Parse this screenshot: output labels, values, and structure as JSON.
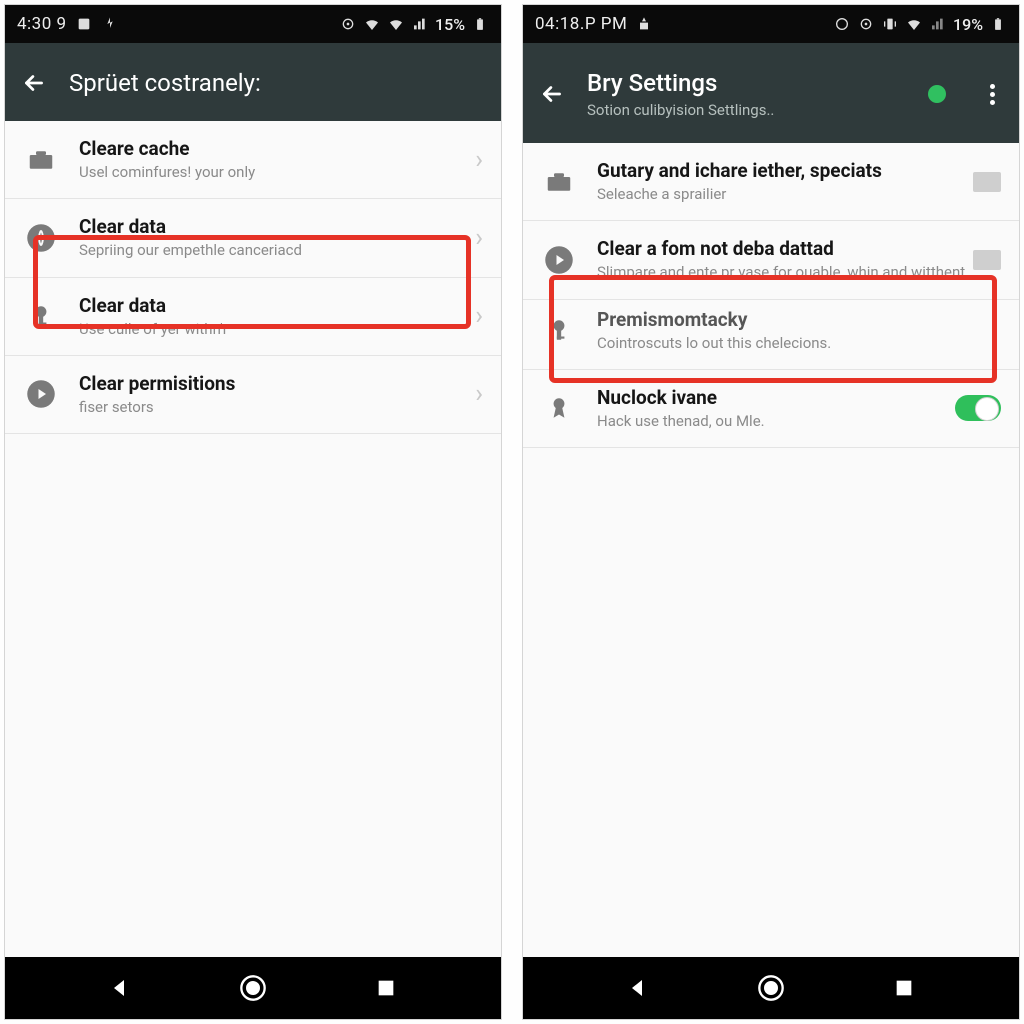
{
  "left_phone": {
    "status": {
      "clock": "4:30 9",
      "battery_pct": "15%"
    },
    "header": {
      "title": "Sprüet costranely:"
    },
    "rows": [
      {
        "icon": "briefcase",
        "title": "Cleare cache",
        "sub": "Usel cominfures! your only",
        "trailing": "chevron"
      },
      {
        "icon": "globe-circle",
        "title": "Clear data",
        "sub": "Sepriing our empethle canceriacd",
        "trailing": "chevron",
        "highlighted": true
      },
      {
        "icon": "key",
        "title": "Clear data",
        "sub": "Use culle of yer withn'r",
        "trailing": "chevron"
      },
      {
        "icon": "play-circle",
        "title": "Clear permisitions",
        "sub": "fiser setors",
        "trailing": "chevron"
      }
    ]
  },
  "right_phone": {
    "status": {
      "clock": "04:18.P PM",
      "battery_pct": "19%"
    },
    "header": {
      "title": "Bry Settings",
      "subtitle": "Sotion culibyision Settlings.."
    },
    "rows": [
      {
        "icon": "briefcase",
        "title": "Gutary and ichare iether, speciats",
        "sub": "Seleache a sprailier",
        "trailing": "checkbox"
      },
      {
        "icon": "play-circle",
        "title": "Clear a fom not deba dattad",
        "sub": "Slimpare and ente pr vase for ouable, whin and witthent.",
        "trailing": "checkbox",
        "highlighted": true
      },
      {
        "icon": "key",
        "title": "Premismomtacky",
        "sub": "Cointroscuts lo out this chelecions.",
        "trailing": "none"
      },
      {
        "icon": "badge",
        "title": "Nuclock ivane",
        "sub": "Hack use thenad, ou Mle.",
        "trailing": "switch-on"
      }
    ]
  }
}
